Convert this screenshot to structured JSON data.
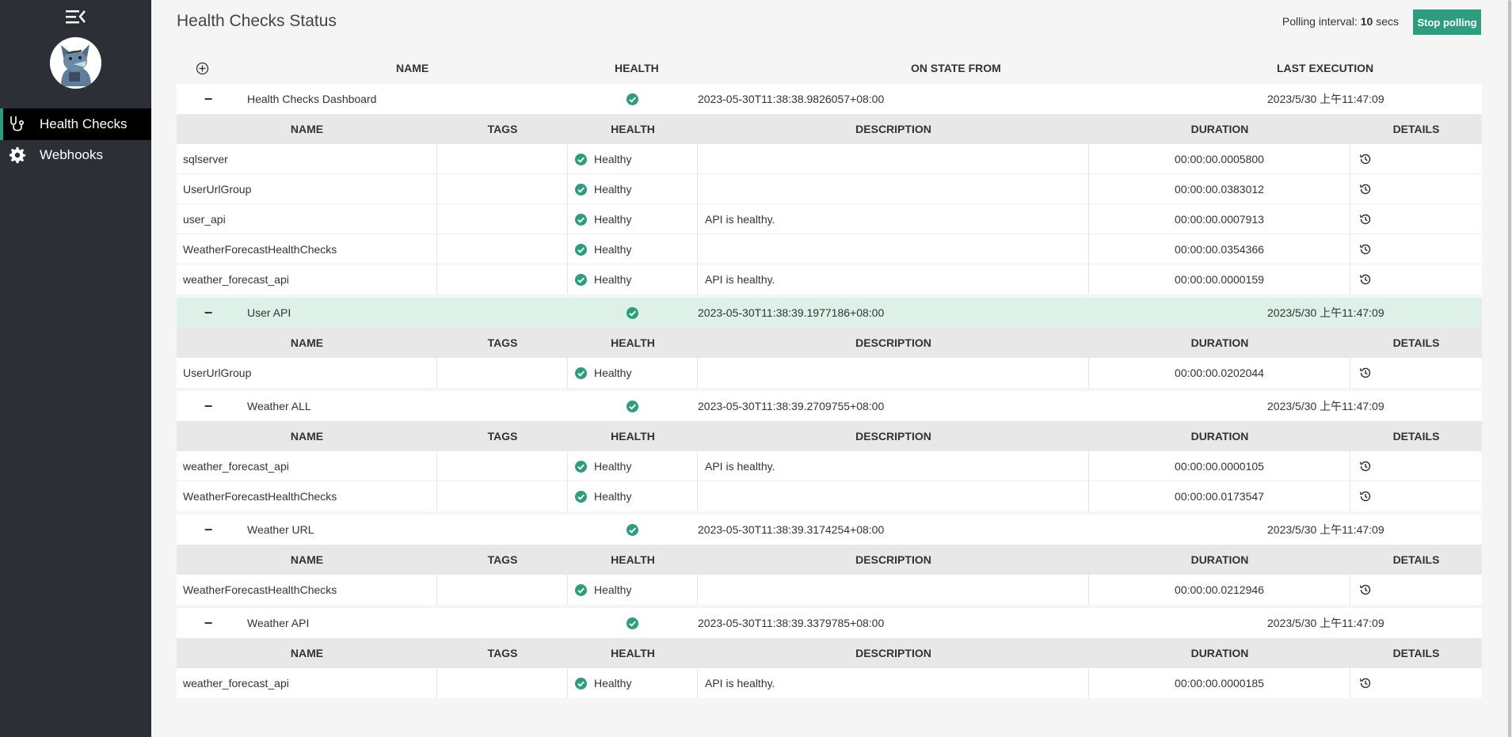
{
  "page_title": "Health Checks Status",
  "polling": {
    "label": "Polling interval:",
    "value": "10",
    "unit": "secs",
    "button": "Stop polling"
  },
  "sidebar": {
    "items": [
      {
        "label": "Health Checks",
        "icon": "stethoscope-icon",
        "active": true
      },
      {
        "label": "Webhooks",
        "icon": "gear-icon",
        "active": false
      }
    ]
  },
  "columns": {
    "name": "NAME",
    "health": "HEALTH",
    "on_state_from": "ON STATE FROM",
    "last_execution": "LAST EXECUTION"
  },
  "sub_columns": {
    "name": "NAME",
    "tags": "TAGS",
    "health": "HEALTH",
    "description": "DESCRIPTION",
    "duration": "DURATION",
    "details": "DETAILS"
  },
  "colors": {
    "accent": "#2e9d7d",
    "sidebar": "#2c2f36",
    "highlight": "#ddf1e9"
  },
  "groups": [
    {
      "name": "Health Checks Dashboard",
      "on_state_from": "2023-05-30T11:38:38.9826057+08:00",
      "last_execution": "2023/5/30 上午11:47:09",
      "entries": [
        {
          "name": "sqlserver",
          "health": "Healthy",
          "description": "",
          "duration": "00:00:00.0005800"
        },
        {
          "name": "UserUrlGroup",
          "health": "Healthy",
          "description": "",
          "duration": "00:00:00.0383012"
        },
        {
          "name": "user_api",
          "health": "Healthy",
          "description": "API is healthy.",
          "duration": "00:00:00.0007913"
        },
        {
          "name": "WeatherForecastHealthChecks",
          "health": "Healthy",
          "description": "",
          "duration": "00:00:00.0354366"
        },
        {
          "name": "weather_forecast_api",
          "health": "Healthy",
          "description": "API is healthy.",
          "duration": "00:00:00.0000159"
        }
      ]
    },
    {
      "name": "User API",
      "on_state_from": "2023-05-30T11:38:39.1977186+08:00",
      "last_execution": "2023/5/30 上午11:47:09",
      "entries": [
        {
          "name": "UserUrlGroup",
          "health": "Healthy",
          "description": "",
          "duration": "00:00:00.0202044"
        }
      ]
    },
    {
      "name": "Weather ALL",
      "on_state_from": "2023-05-30T11:38:39.2709755+08:00",
      "last_execution": "2023/5/30 上午11:47:09",
      "entries": [
        {
          "name": "weather_forecast_api",
          "health": "Healthy",
          "description": "API is healthy.",
          "duration": "00:00:00.0000105"
        },
        {
          "name": "WeatherForecastHealthChecks",
          "health": "Healthy",
          "description": "",
          "duration": "00:00:00.0173547"
        }
      ]
    },
    {
      "name": "Weather URL",
      "on_state_from": "2023-05-30T11:38:39.3174254+08:00",
      "last_execution": "2023/5/30 上午11:47:09",
      "entries": [
        {
          "name": "WeatherForecastHealthChecks",
          "health": "Healthy",
          "description": "",
          "duration": "00:00:00.0212946"
        }
      ]
    },
    {
      "name": "Weather API",
      "on_state_from": "2023-05-30T11:38:39.3379785+08:00",
      "last_execution": "2023/5/30 上午11:47:09",
      "entries": [
        {
          "name": "weather_forecast_api",
          "health": "Healthy",
          "description": "API is healthy.",
          "duration": "00:00:00.0000185"
        }
      ]
    }
  ]
}
